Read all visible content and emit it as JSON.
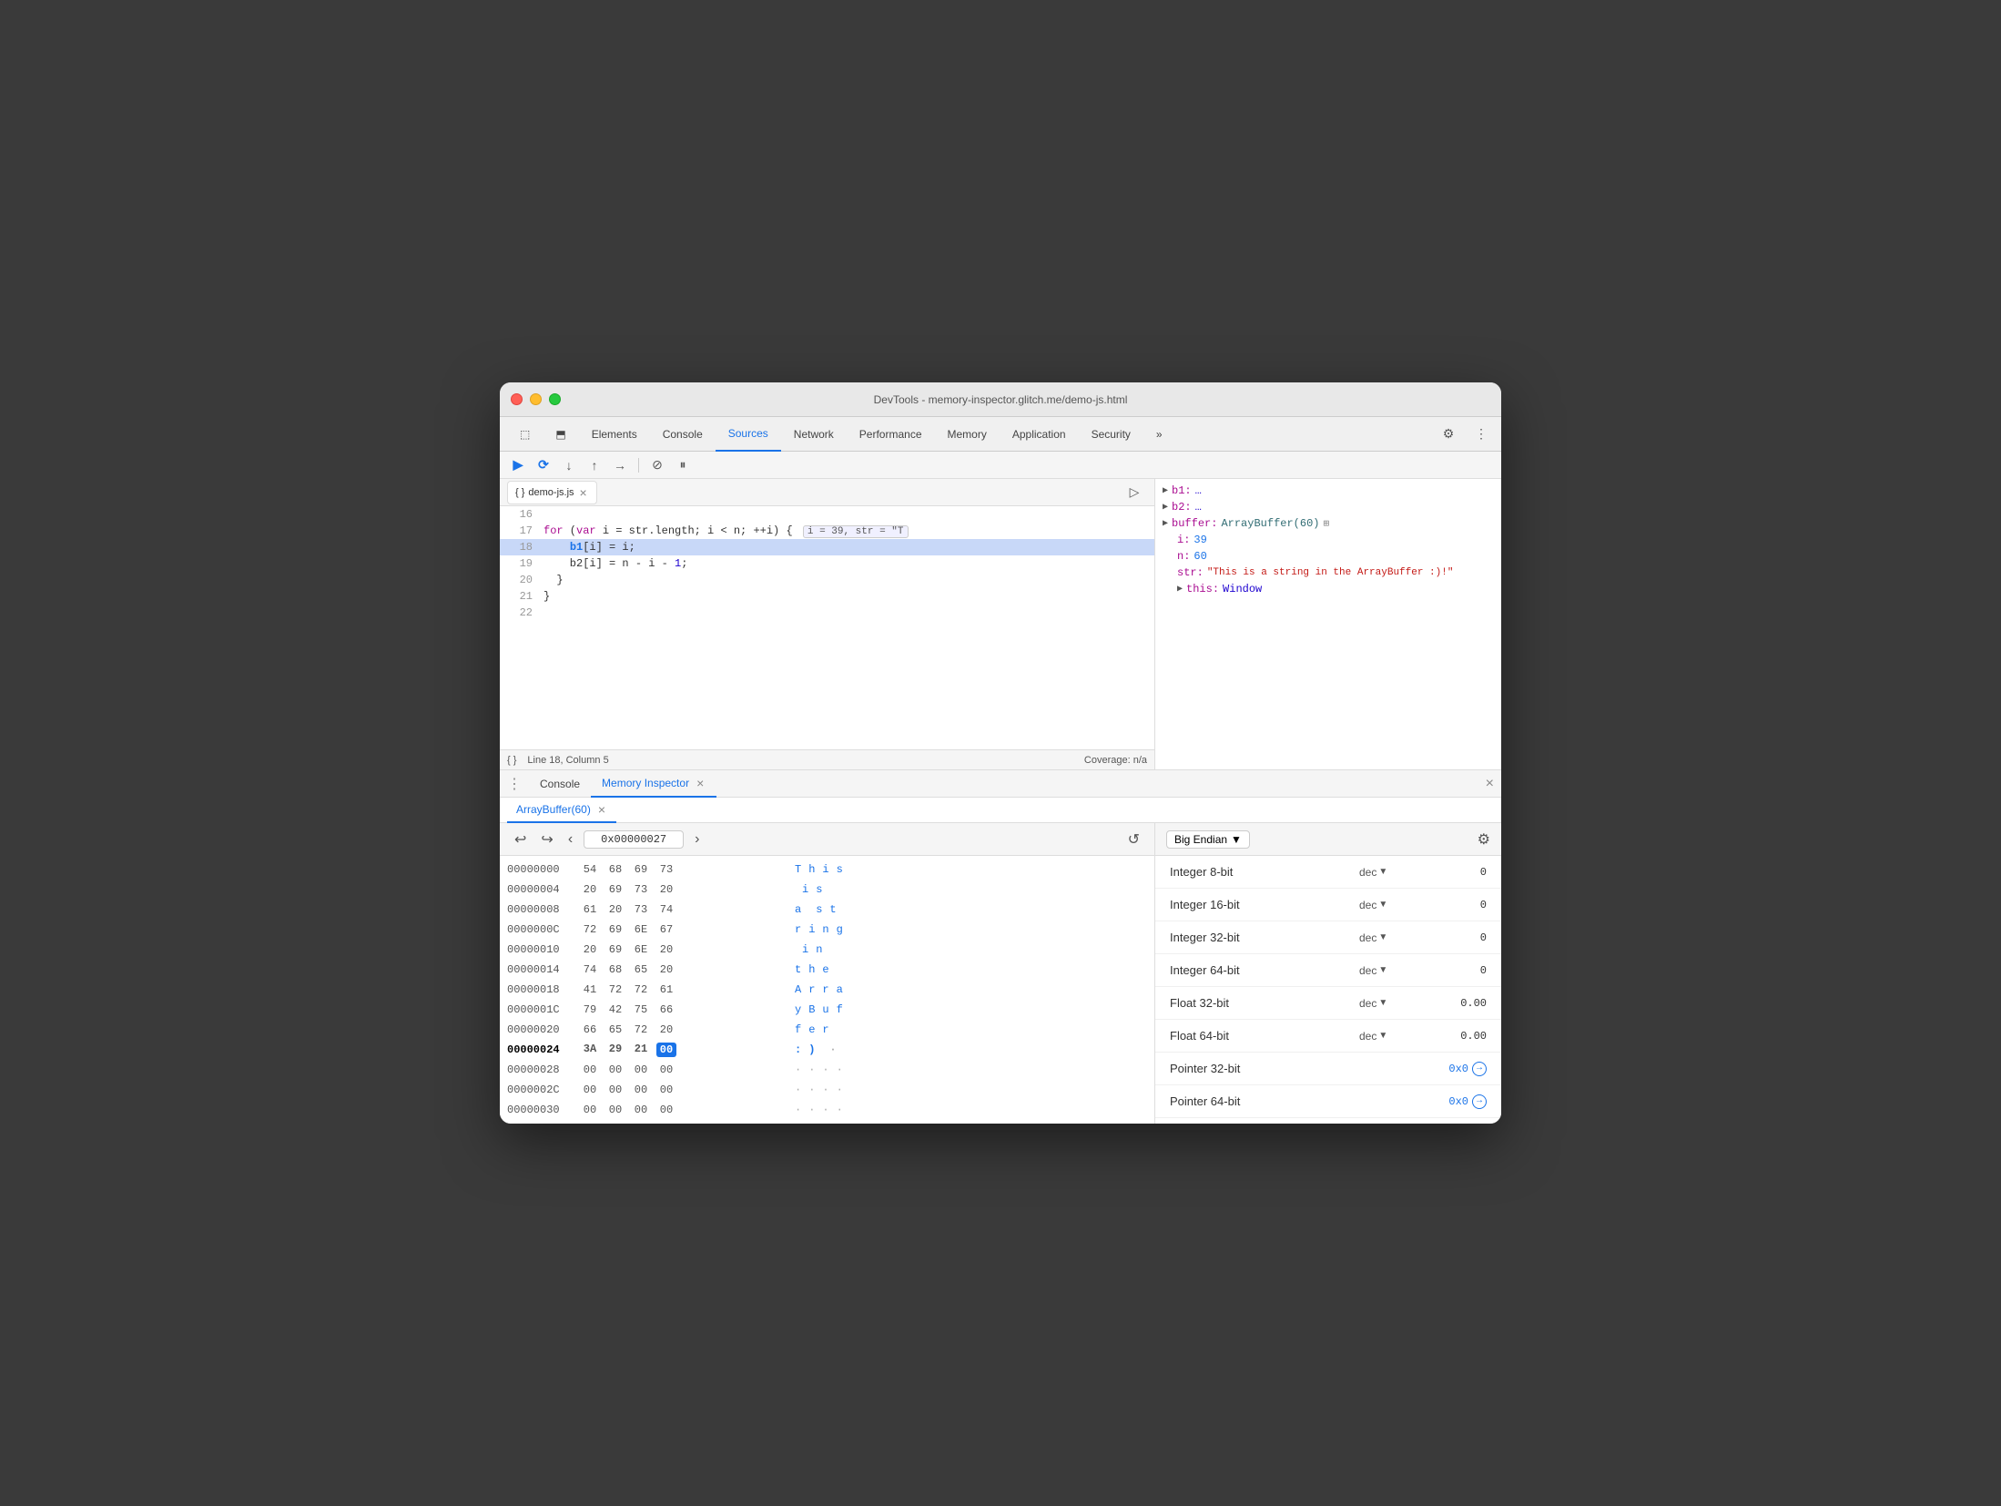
{
  "window": {
    "title": "DevTools - memory-inspector.glitch.me/demo-js.html"
  },
  "tabs": [
    {
      "id": "cursor",
      "label": ""
    },
    {
      "id": "elements",
      "label": "Elements"
    },
    {
      "id": "console",
      "label": "Console"
    },
    {
      "id": "sources",
      "label": "Sources",
      "active": true
    },
    {
      "id": "network",
      "label": "Network"
    },
    {
      "id": "performance",
      "label": "Performance"
    },
    {
      "id": "memory",
      "label": "Memory"
    },
    {
      "id": "application",
      "label": "Application"
    },
    {
      "id": "security",
      "label": "Security"
    },
    {
      "id": "more",
      "label": "»"
    }
  ],
  "source_file": {
    "name": "demo-js.js",
    "code_lines": [
      {
        "num": "16",
        "content": ""
      },
      {
        "num": "17",
        "content": "  for (var i = str.length; i < n; ++i) {",
        "inline_val": "i = 39, str = \"T"
      },
      {
        "num": "18",
        "content": "    b1[i] = i;",
        "highlighted": true
      },
      {
        "num": "19",
        "content": "    b2[i] = n - i - 1;"
      },
      {
        "num": "20",
        "content": "  }"
      },
      {
        "num": "21",
        "content": "}"
      },
      {
        "num": "22",
        "content": ""
      }
    ],
    "status_left": "Line 18, Column 5",
    "status_right": "Coverage: n/a"
  },
  "scope": {
    "entries": [
      {
        "key": "b1:",
        "val": "…",
        "arrow": true
      },
      {
        "key": "b2:",
        "val": "…",
        "arrow": true
      },
      {
        "key": "buffer:",
        "val": "ArrayBuffer(60)",
        "icon": "📦",
        "arrow": true,
        "highlight": true
      },
      {
        "key": "i:",
        "val": "39",
        "indent": true,
        "color": "blue"
      },
      {
        "key": "n:",
        "val": "60",
        "indent": true,
        "color": "blue"
      },
      {
        "key": "str:",
        "val": "\"This is a string in the ArrayBuffer :)!\"",
        "indent": true,
        "color": "red"
      },
      {
        "key": "▶ this:",
        "val": "Window",
        "indent": true
      }
    ]
  },
  "panel_tabs": [
    {
      "id": "console",
      "label": "Console"
    },
    {
      "id": "memory_inspector",
      "label": "Memory Inspector",
      "active": true
    }
  ],
  "arraybuffer_tab": {
    "label": "ArrayBuffer(60)"
  },
  "hex_toolbar": {
    "address": "0x00000027",
    "back_label": "‹",
    "forward_label": "›"
  },
  "hex_rows": [
    {
      "addr": "00000000",
      "bytes": [
        "54",
        "68",
        "69",
        "73"
      ],
      "chars": [
        "T",
        "h",
        "i",
        "s"
      ],
      "active": false
    },
    {
      "addr": "00000004",
      "bytes": [
        "20",
        "69",
        "73",
        "20"
      ],
      "chars": [
        " ",
        "i",
        "s",
        " "
      ],
      "active": false
    },
    {
      "addr": "00000008",
      "bytes": [
        "61",
        "20",
        "73",
        "74"
      ],
      "chars": [
        "a",
        " ",
        "s",
        "t"
      ],
      "active": false
    },
    {
      "addr": "0000000C",
      "bytes": [
        "72",
        "69",
        "6E",
        "67"
      ],
      "chars": [
        "r",
        "i",
        "n",
        "g"
      ],
      "active": false
    },
    {
      "addr": "00000010",
      "bytes": [
        "20",
        "69",
        "6E",
        "20"
      ],
      "chars": [
        " ",
        "i",
        "n",
        " "
      ],
      "active": false
    },
    {
      "addr": "00000014",
      "bytes": [
        "74",
        "68",
        "65",
        "20"
      ],
      "chars": [
        "t",
        "h",
        "e",
        " "
      ],
      "active": false
    },
    {
      "addr": "00000018",
      "bytes": [
        "41",
        "72",
        "72",
        "61"
      ],
      "chars": [
        "A",
        "r",
        "r",
        "a"
      ],
      "active": false
    },
    {
      "addr": "0000001C",
      "bytes": [
        "79",
        "42",
        "75",
        "66"
      ],
      "chars": [
        "y",
        "B",
        "u",
        "f"
      ],
      "active": false
    },
    {
      "addr": "00000020",
      "bytes": [
        "66",
        "65",
        "72",
        "20"
      ],
      "chars": [
        "f",
        "e",
        "r",
        " "
      ],
      "active": false
    },
    {
      "addr": "00000024",
      "bytes": [
        "3A",
        "29",
        "21",
        "00"
      ],
      "chars": [
        ":",
        ")",
        " ",
        "·"
      ],
      "active": true,
      "selected_byte": 3
    },
    {
      "addr": "00000028",
      "bytes": [
        "00",
        "00",
        "00",
        "00"
      ],
      "chars": [
        "·",
        "·",
        "·",
        "·"
      ],
      "active": false
    },
    {
      "addr": "0000002C",
      "bytes": [
        "00",
        "00",
        "00",
        "00"
      ],
      "chars": [
        "·",
        "·",
        "·",
        "·"
      ],
      "active": false
    },
    {
      "addr": "00000030",
      "bytes": [
        "00",
        "00",
        "00",
        "00"
      ],
      "chars": [
        "·",
        "·",
        "·",
        "·"
      ],
      "active": false
    }
  ],
  "value_panel": {
    "endian": "Big Endian",
    "rows": [
      {
        "label": "Integer 8-bit",
        "format": "dec",
        "value": "0"
      },
      {
        "label": "Integer 16-bit",
        "format": "dec",
        "value": "0"
      },
      {
        "label": "Integer 32-bit",
        "format": "dec",
        "value": "0"
      },
      {
        "label": "Integer 64-bit",
        "format": "dec",
        "value": "0"
      },
      {
        "label": "Float 32-bit",
        "format": "dec",
        "value": "0.00"
      },
      {
        "label": "Float 64-bit",
        "format": "dec",
        "value": "0.00"
      },
      {
        "label": "Pointer 32-bit",
        "format": "",
        "value": "0x0",
        "link": true
      },
      {
        "label": "Pointer 64-bit",
        "format": "",
        "value": "0x0",
        "link": true
      }
    ]
  },
  "labels": {
    "panel_close": "×",
    "refresh": "↺",
    "gear": "⚙",
    "arrow_down": "▼",
    "check": "✓"
  }
}
